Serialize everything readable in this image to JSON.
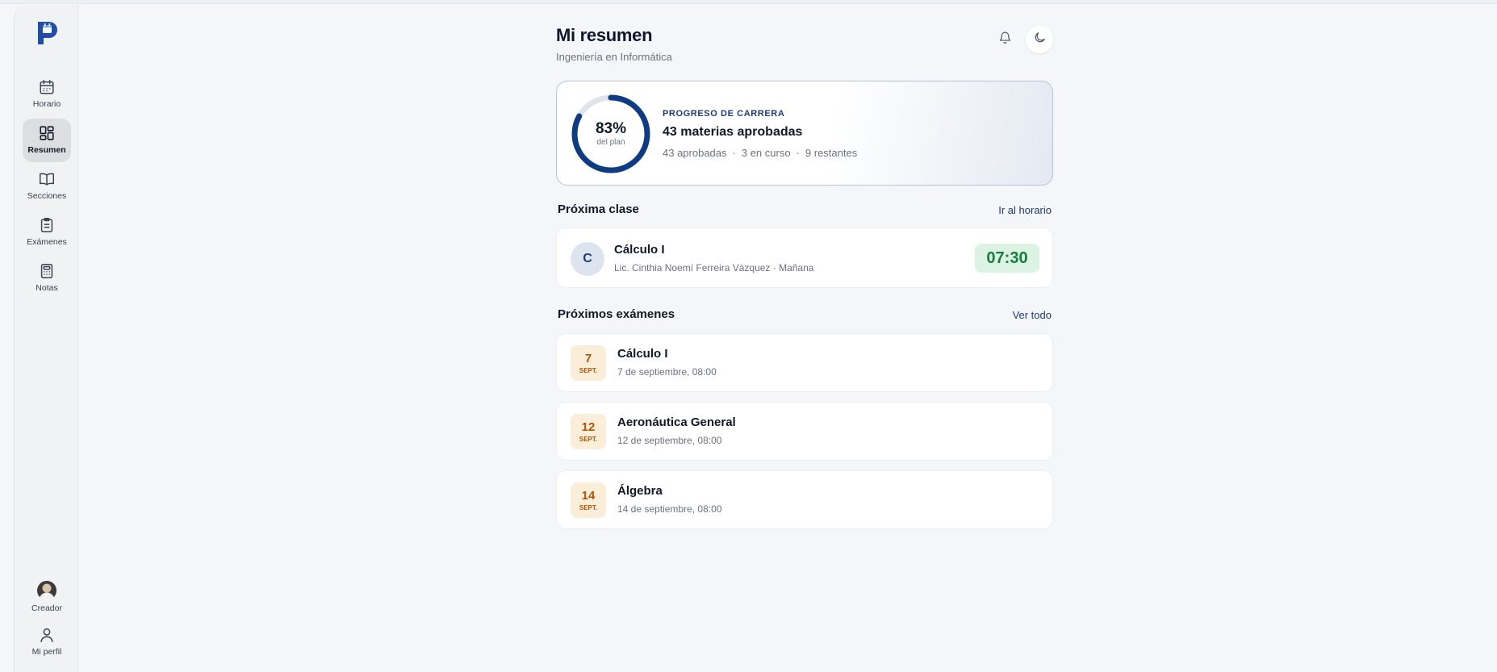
{
  "sidebar": {
    "items": [
      {
        "label": "Horario",
        "icon": "calendar-icon"
      },
      {
        "label": "Resumen",
        "icon": "dashboard-icon",
        "active": true
      },
      {
        "label": "Secciones",
        "icon": "book-icon"
      },
      {
        "label": "Exámenes",
        "icon": "clipboard-icon"
      },
      {
        "label": "Notas",
        "icon": "calculator-icon"
      }
    ],
    "bottom": [
      {
        "label": "Creador",
        "icon": "avatar"
      },
      {
        "label": "Mi perfil",
        "icon": "user-icon"
      }
    ]
  },
  "header": {
    "title": "Mi resumen",
    "subtitle": "Ingeniería en Informática"
  },
  "progress": {
    "label": "PROGRESO DE CARRERA",
    "percent_text": "83%",
    "percent_value": 0.83,
    "ring_sub": "del plan",
    "title": "43 materias aprobadas",
    "stat_approved": "43 aprobadas",
    "stat_in_progress": "3 en curso",
    "stat_remaining": "9 restantes",
    "separator": "·"
  },
  "next_class": {
    "heading": "Próxima clase",
    "link": "Ir al horario",
    "initial": "C",
    "name": "Cálculo I",
    "meta": "Lic. Cinthia Noemí Ferreira Vázquez · Mañana",
    "time": "07:30"
  },
  "exams": {
    "heading": "Próximos exámenes",
    "link": "Ver todo",
    "items": [
      {
        "day": "7",
        "month": "SEPT.",
        "name": "Cálculo I",
        "date": "7 de septiembre, 08:00"
      },
      {
        "day": "12",
        "month": "SEPT.",
        "name": "Aeronáutica General",
        "date": "12 de septiembre, 08:00"
      },
      {
        "day": "14",
        "month": "SEPT.",
        "name": "Álgebra",
        "date": "14 de septiembre, 08:00"
      }
    ]
  },
  "colors": {
    "accent": "#1e3a78",
    "ring": "#0f3b82",
    "time_green": "#15803d",
    "date_orange": "#b45309"
  }
}
